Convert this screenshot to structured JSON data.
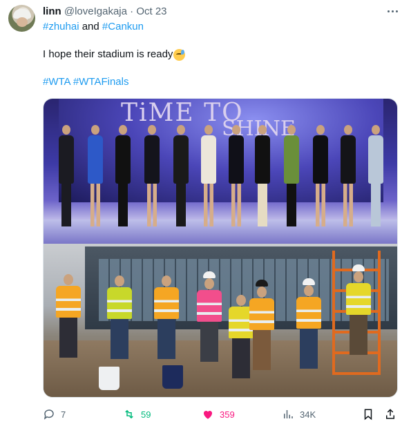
{
  "tweet": {
    "author_name": "linn",
    "handle": "@loveIgakaja",
    "separator": "·",
    "date": "Oct 23",
    "hashtag_line": {
      "tag1": "#zhuhai",
      "connector": "and",
      "tag2": "#Cankun"
    },
    "text": "I hope their stadium is ready",
    "emoji": "downcast-face-with-sweat",
    "hashtags": [
      "#WTA",
      "#WTAFinals"
    ],
    "media": {
      "top_banner_text_1": "TiME TO",
      "top_banner_text_2": "SHINE"
    }
  },
  "actions": {
    "replies": "7",
    "retweets": "59",
    "likes": "359",
    "views": "34K"
  },
  "colors": {
    "link": "#1d9bf0",
    "secondary_text": "#536471",
    "retweet": "#00ba7c",
    "like": "#f91880"
  }
}
